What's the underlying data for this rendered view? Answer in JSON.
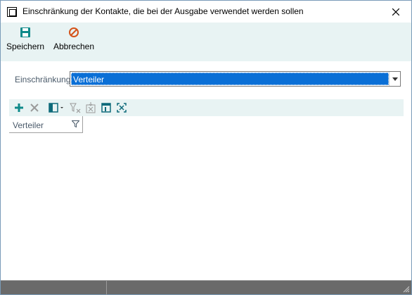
{
  "window": {
    "title": "Einschränkung der Kontakte, die bei der Ausgabe verwendet werden sollen",
    "close_icon": "close-icon"
  },
  "ribbon": {
    "save_label": "Speichern",
    "cancel_label": "Abbrechen",
    "save_icon": "floppy-disk-icon",
    "cancel_icon": "cancel-circle-icon"
  },
  "form": {
    "restriction_label": "Einschränkung",
    "restriction_value": "Verteiler"
  },
  "grid": {
    "toolbar_icons": [
      "add-icon",
      "delete-icon",
      "columns-icon",
      "clear-filter-icon",
      "export-icon",
      "layout-icon",
      "fit-icon"
    ],
    "column_header": "Verteiler"
  },
  "colors": {
    "accent": "#0a6fd6",
    "ribbon_bg": "#e8f3f3",
    "icon_teal": "#0e8a8a",
    "cancel_orange": "#d4531a",
    "statusbar": "#6a6a6a"
  }
}
